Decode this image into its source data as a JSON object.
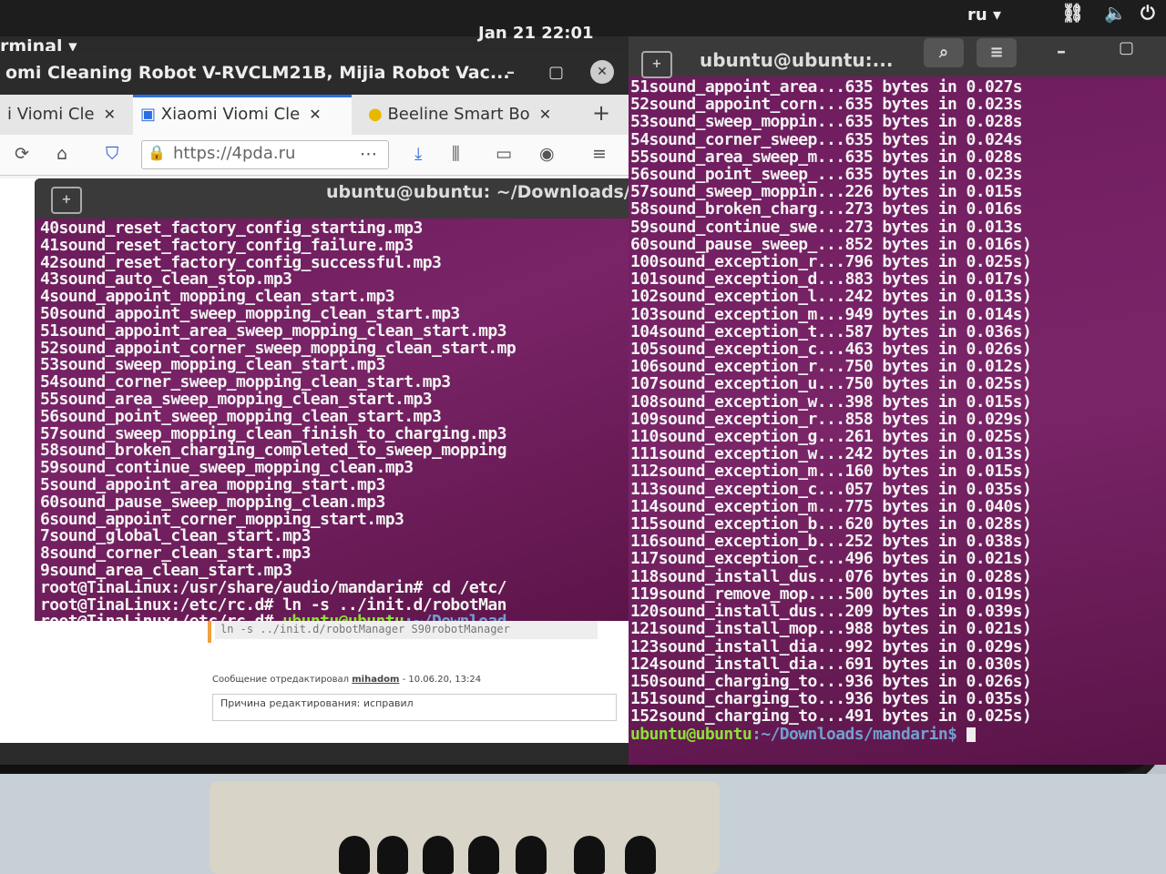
{
  "topbar": {
    "app_menu": "rminal ▾",
    "clock": "Jan 21  22:01",
    "lang": "ru ▾",
    "network_icon": "network-icon",
    "volume_icon": "volume-icon",
    "power_icon": "power-icon"
  },
  "firefox": {
    "window_title": "omi Cleaning Robot V-RVCLM21B, Mijia Robot Vac...",
    "minimize": "–",
    "maximize": "▢",
    "close": "✕",
    "tabs": [
      {
        "label": "i Viomi Cle",
        "close": "✕"
      },
      {
        "label": "Xiaomi Viomi Cle",
        "close": "✕"
      },
      {
        "label": "Beeline Smart Bo",
        "close": "✕"
      }
    ],
    "new_tab": "+",
    "url": "https://4pda.ru",
    "code_line": "ln -s ../init.d/robotManager S90robotManager",
    "edited_prefix": "Сообщение отредактировал",
    "edited_user": "mihadom",
    "edited_date": "- 10.06.20, 13:24",
    "reason": "Причина редактирования: исправил"
  },
  "left_terminal": {
    "title": "ubuntu@ubuntu: ~/Downloads/m",
    "lines": [
      "40sound_reset_factory_config_starting.mp3",
      "41sound_reset_factory_config_failure.mp3",
      "42sound_reset_factory_config_successful.mp3",
      "43sound_auto_clean_stop.mp3",
      "4sound_appoint_mopping_clean_start.mp3",
      "50sound_appoint_sweep_mopping_clean_start.mp3",
      "51sound_appoint_area_sweep_mopping_clean_start.mp3",
      "52sound_appoint_corner_sweep_mopping_clean_start.mp",
      "53sound_sweep_mopping_clean_start.mp3",
      "54sound_corner_sweep_mopping_clean_start.mp3",
      "55sound_area_sweep_mopping_clean_start.mp3",
      "56sound_point_sweep_mopping_clean_start.mp3",
      "57sound_sweep_mopping_clean_finish_to_charging.mp3",
      "58sound_broken_charging_completed_to_sweep_mopping",
      "59sound_continue_sweep_mopping_clean.mp3",
      "5sound_appoint_area_mopping_start.mp3",
      "60sound_pause_sweep_mopping_clean.mp3",
      "6sound_appoint_corner_mopping_start.mp3",
      "7sound_global_clean_start.mp3",
      "8sound_corner_clean_start.mp3",
      "9sound_area_clean_start.mp3",
      "root@TinaLinux:/usr/share/audio/mandarin# cd /etc/",
      "root@TinaLinux:/etc/rc.d# ln -s ../init.d/robotMan"
    ],
    "last_prefix": "root@TinaLinux:/etc/rc.d# ",
    "last_user": "ubuntu@ubuntu",
    "last_path": ":~/Download"
  },
  "right_terminal": {
    "title": "ubuntu@ubuntu:...",
    "search_icon": "search-icon",
    "menu_icon": "hamburger-menu-icon",
    "minimize": "–",
    "maximize": "▢",
    "lines": [
      "51sound_appoint_area...635 bytes in 0.027s",
      "52sound_appoint_corn...635 bytes in 0.023s",
      "53sound_sweep_moppin...635 bytes in 0.028s",
      "54sound_corner_sweep...635 bytes in 0.024s",
      "55sound_area_sweep_m...635 bytes in 0.028s",
      "56sound_point_sweep_...635 bytes in 0.023s",
      "57sound_sweep_moppin...226 bytes in 0.015s",
      "58sound_broken_charg...273 bytes in 0.016s",
      "59sound_continue_swe...273 bytes in 0.013s",
      "60sound_pause_sweep_...852 bytes in 0.016s)",
      "100sound_exception_r...796 bytes in 0.025s)",
      "101sound_exception_d...883 bytes in 0.017s)",
      "102sound_exception_l...242 bytes in 0.013s)",
      "103sound_exception_m...949 bytes in 0.014s)",
      "104sound_exception_t...587 bytes in 0.036s)",
      "105sound_exception_c...463 bytes in 0.026s)",
      "106sound_exception_r...750 bytes in 0.012s)",
      "107sound_exception_u...750 bytes in 0.025s)",
      "108sound_exception_w...398 bytes in 0.015s)",
      "109sound_exception_r...858 bytes in 0.029s)",
      "110sound_exception_g...261 bytes in 0.025s)",
      "111sound_exception_w...242 bytes in 0.013s)",
      "112sound_exception_m...160 bytes in 0.015s)",
      "113sound_exception_c...057 bytes in 0.035s)",
      "114sound_exception_m...775 bytes in 0.040s)",
      "115sound_exception_b...620 bytes in 0.028s)",
      "116sound_exception_b...252 bytes in 0.038s)",
      "117sound_exception_c...496 bytes in 0.021s)",
      "118sound_install_dus...076 bytes in 0.028s)",
      "119sound_remove_mop....500 bytes in 0.019s)",
      "120sound_install_dus...209 bytes in 0.039s)",
      "121sound_install_mop...988 bytes in 0.021s)",
      "123sound_install_dia...992 bytes in 0.029s)",
      "124sound_install_dia...691 bytes in 0.030s)",
      "150sound_charging_to...936 bytes in 0.026s)",
      "151sound_charging_to...936 bytes in 0.035s)",
      "152sound_charging_to...491 bytes in 0.025s)"
    ],
    "prompt_user": "ubuntu@ubuntu",
    "prompt_path": ":~/Downloads/mandarin$"
  }
}
